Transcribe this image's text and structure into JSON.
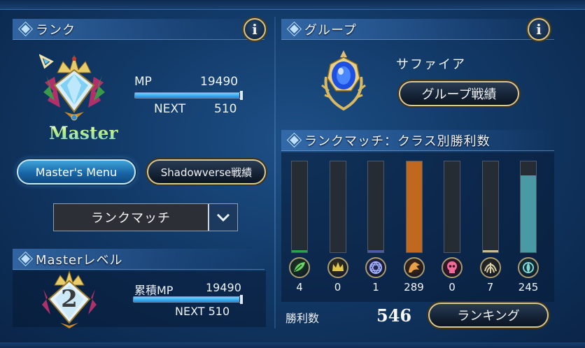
{
  "rank": {
    "header": "ランク",
    "info": "i",
    "tier_name": "Master",
    "mp_label": "MP",
    "mp_value": "19490",
    "mp_progress": 0.98,
    "next_label": "NEXT",
    "next_value": "510",
    "masters_menu_button": "Master's Menu",
    "stats_button": "Shadowverse戦績",
    "mode_select": "ランクマッチ"
  },
  "master_level": {
    "header": "Masterレベル",
    "level": "2",
    "total_mp_label": "累積MP",
    "total_mp_value": "19490",
    "total_mp_progress": 0.98,
    "next_text": "NEXT 510"
  },
  "group": {
    "header": "グループ",
    "info": "i",
    "name": "サファイア",
    "stats_button": "グループ戦績"
  },
  "class_wins": {
    "header": "ランクマッチ：クラス別勝利数",
    "wins_label": "勝利数",
    "wins_total": "546",
    "ranking_button": "ランキング"
  },
  "chart_data": {
    "type": "bar",
    "title": "ランクマッチ：クラス別勝利数",
    "categories": [
      "forestcraft",
      "swordcraft",
      "runecraft",
      "dragoncraft",
      "shadowcraft",
      "bloodcraft",
      "havencraft"
    ],
    "values": [
      4,
      0,
      1,
      289,
      0,
      7,
      245
    ],
    "ylim": [
      0,
      289
    ],
    "colors": [
      "#2aa24a",
      "#9a8f3a",
      "#4a5ea8",
      "#c0681e",
      "#b83a5a",
      "#c8bc90",
      "#4a9aa5"
    ],
    "icons": [
      "leaf-icon",
      "crown-icon",
      "rune-icon",
      "dragon-icon",
      "skull-icon",
      "wing-icon",
      "haven-icon"
    ]
  }
}
